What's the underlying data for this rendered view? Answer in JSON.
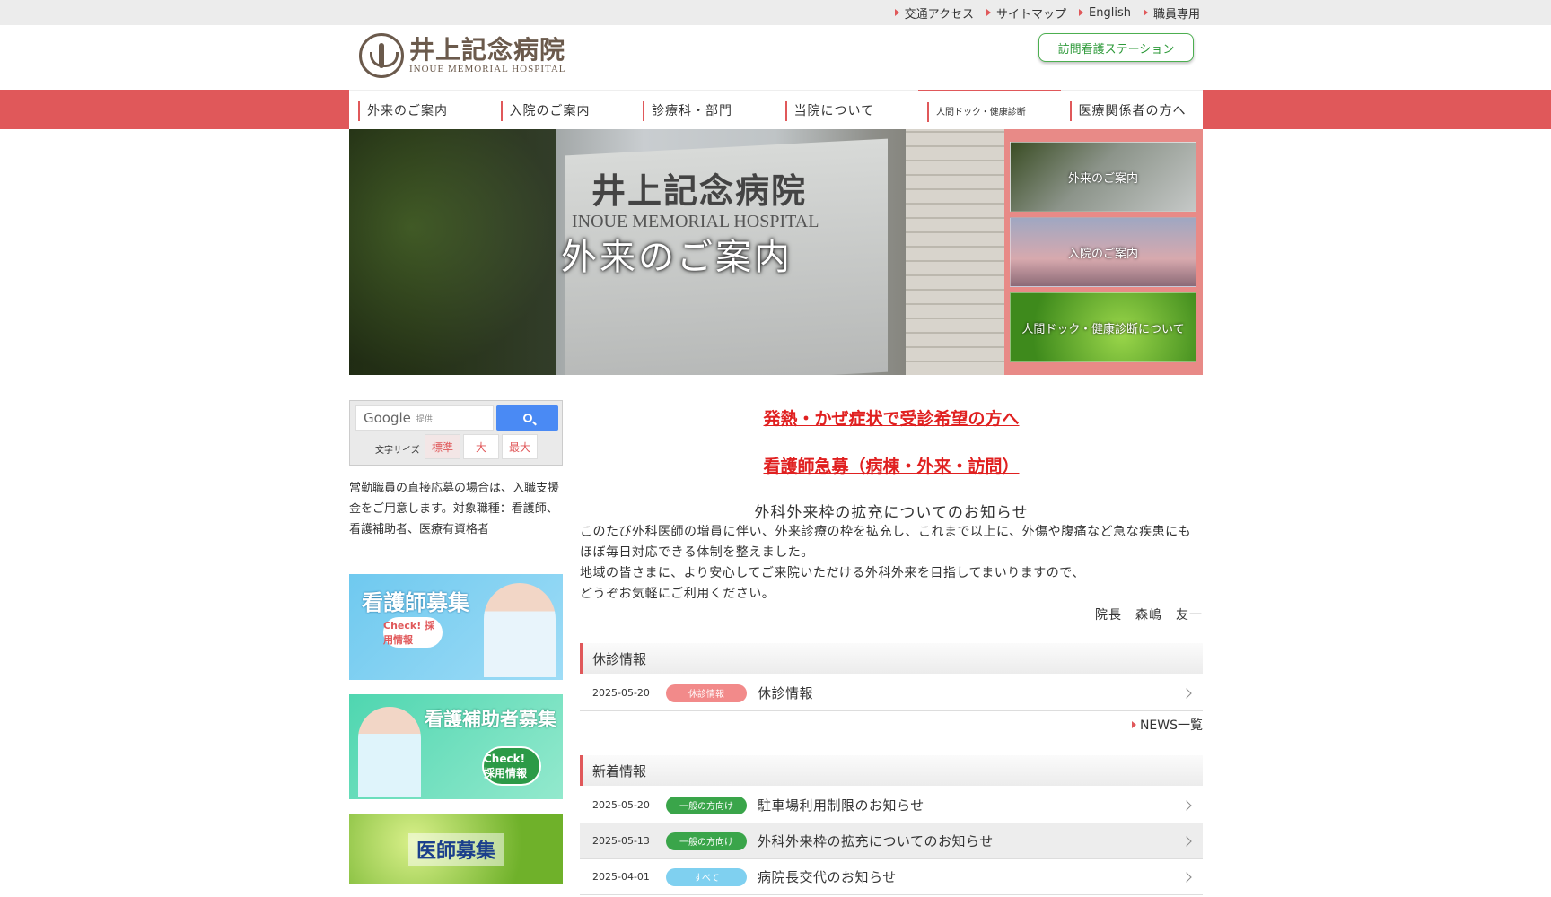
{
  "colors": {
    "accent": "#e0585a",
    "green": "#2e9a3a",
    "badge_kyushin": "#f28a8a",
    "badge_general": "#3aa54a",
    "badge_all": "#7fd0f0"
  },
  "top_links": [
    {
      "label": "交通アクセス"
    },
    {
      "label": "サイトマップ"
    },
    {
      "label": "English"
    },
    {
      "label": "職員専用"
    }
  ],
  "logo": {
    "jp": "井上記念病院",
    "en": "INOUE MEMORIAL HOSPITAL"
  },
  "visit_nursing_button": "訪問看護ステーション",
  "nav": [
    {
      "label": "外来のご案内"
    },
    {
      "label": "入院のご案内"
    },
    {
      "label": "診療科・部門"
    },
    {
      "label": "当院について"
    },
    {
      "label": "人間ドック・健康診断"
    },
    {
      "label": "医療関係者の方へ"
    }
  ],
  "hero": {
    "title": "外来のご案内",
    "sign_jp": "井上記念病院",
    "sign_en": "INOUE MEMORIAL HOSPITAL"
  },
  "hero_tiles": [
    {
      "label": "外来のご案内"
    },
    {
      "label": "入院のご案内"
    },
    {
      "label": "人間ドック・健康診断について"
    }
  ],
  "search": {
    "brand": "Google",
    "placeholder": "提供"
  },
  "font_size": {
    "label": "文字サイズ",
    "options": [
      "標準",
      "大",
      "最大"
    ]
  },
  "recruit_note": "常勤職員の直接応募の場合は、入職支援金をご用意します。対象職種：看護師、看護補助者、医療有資格者",
  "banners": {
    "nurse": {
      "title": "看護師募集",
      "check": "Check! 採用情報"
    },
    "assistant": {
      "title": "看護補助者募集",
      "check": "Check! 採用情報"
    },
    "doctor": {
      "title": "医師募集"
    }
  },
  "alerts": [
    "発熱・かぜ症状で受診希望の方へ",
    "看護師急募（病棟・外来・訪問）"
  ],
  "notice": {
    "title": "外科外来枠の拡充についてのお知らせ",
    "body": [
      "このたび外科医師の増員に伴い、外来診療の枠を拡充し、これまで以上に、外傷や腹痛など急な疾患にも",
      "ほぼ毎日対応できる体制を整えました。",
      "地域の皆さまに、より安心してご来院いただける外科外来を目指してまいりますので、",
      "どうぞお気軽にご利用ください。"
    ],
    "signature": "院長　森嶋　友一"
  },
  "kyushin": {
    "heading": "休診情報",
    "items": [
      {
        "date": "2025-05-20",
        "badge": "休診情報",
        "title": "休診情報"
      }
    ],
    "more": "NEWS一覧"
  },
  "news": {
    "heading": "新着情報",
    "items": [
      {
        "date": "2025-05-20",
        "badge": "一般の方向け",
        "title": "駐車場利用制限のお知らせ"
      },
      {
        "date": "2025-05-13",
        "badge": "一般の方向け",
        "title": "外科外来枠の拡充についてのお知らせ"
      },
      {
        "date": "2025-04-01",
        "badge": "すべて",
        "title": "病院長交代のお知らせ"
      }
    ]
  }
}
